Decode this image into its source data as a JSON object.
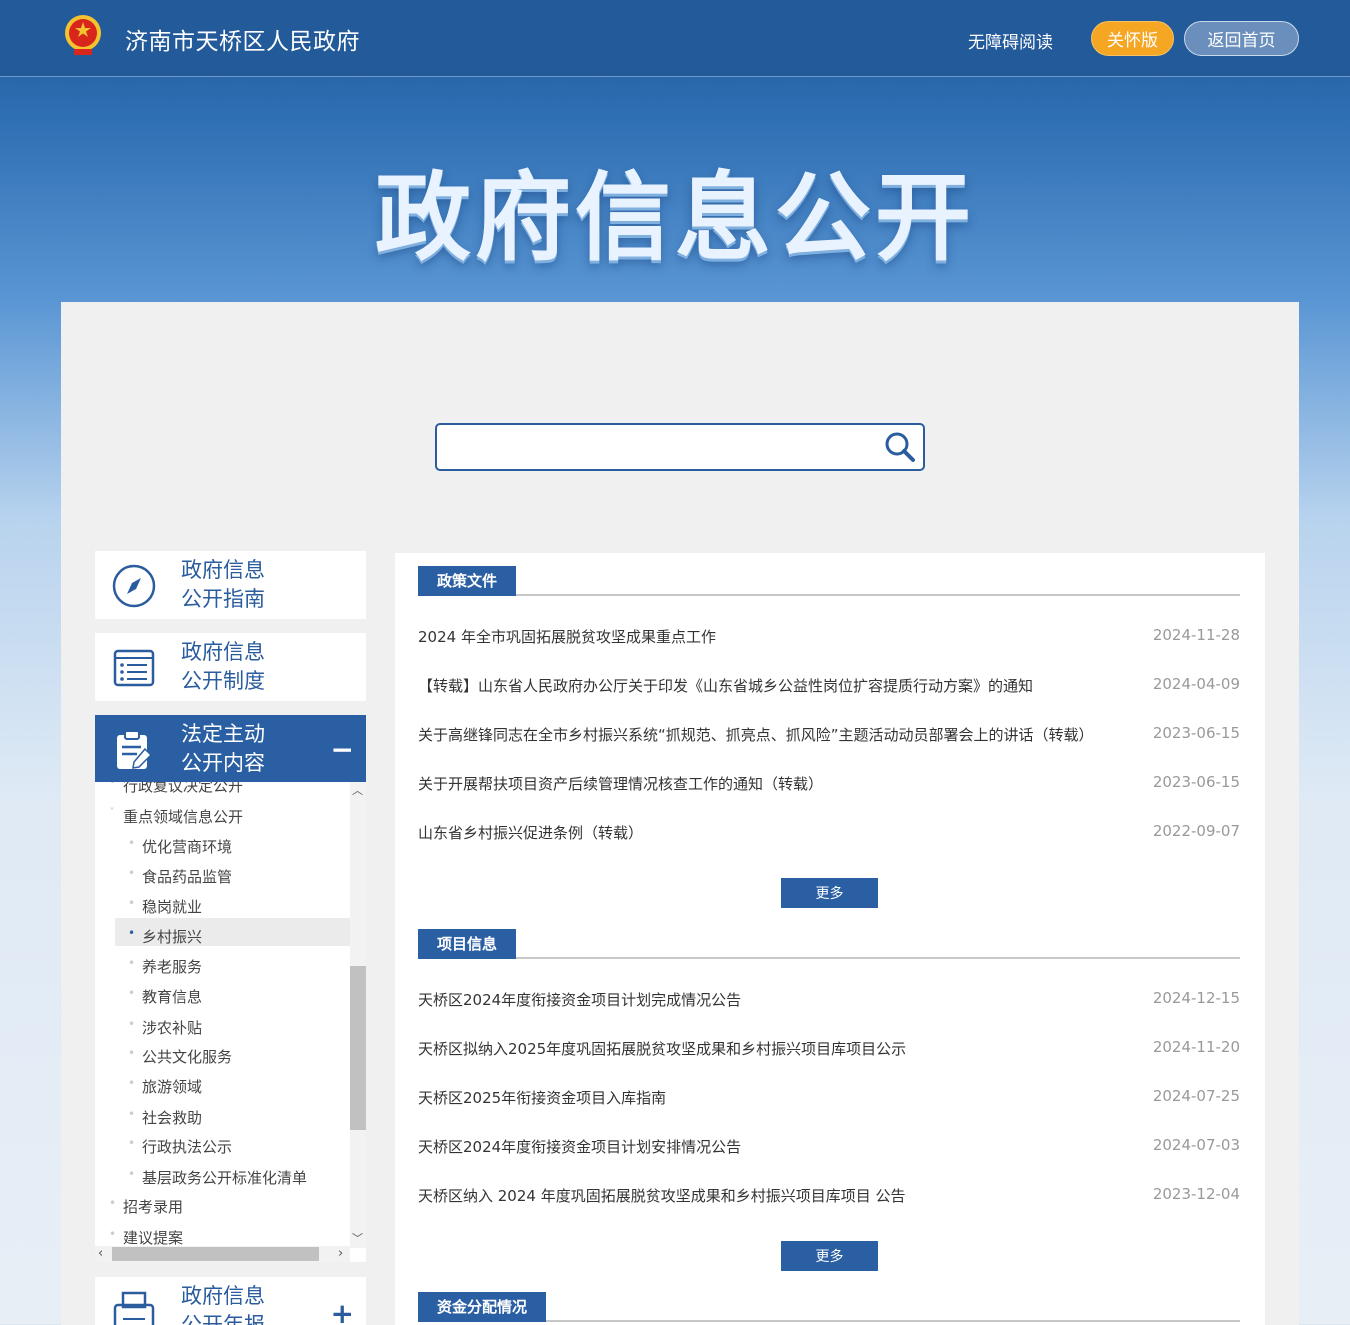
{
  "header": {
    "site_title": "济南市天桥区人民政府",
    "a11y_label": "无障碍阅读",
    "care_label": "关怀版",
    "home_label": "返回首页"
  },
  "hero": {
    "title": "政府信息公开"
  },
  "search": {
    "value": "",
    "placeholder": ""
  },
  "sidebar": {
    "cards": [
      {
        "label_1": "政府信息",
        "label_2": "公开指南",
        "icon": "compass-icon"
      },
      {
        "label_1": "政府信息",
        "label_2": "公开制度",
        "icon": "document-list-icon"
      },
      {
        "label_1": "法定主动",
        "label_2": "公开内容",
        "icon": "clipboard-edit-icon",
        "toggle": "−"
      },
      {
        "label_1": "政府信息",
        "label_2": "公开年报",
        "icon": "printer-icon",
        "toggle": "+"
      }
    ],
    "tree": [
      "行政复议决定公开",
      "重点领域信息公开",
      "优化营商环境",
      "食品药品监管",
      "稳岗就业",
      "乡村振兴",
      "养老服务",
      "教育信息",
      "涉农补贴",
      "公共文化服务",
      "旅游领域",
      "社会救助",
      "行政执法公示",
      "基层政务公开标准化清单",
      "招考录用",
      "建议提案"
    ],
    "selected": "乡村振兴"
  },
  "sections": [
    {
      "title": "政策文件",
      "items": [
        {
          "title": "2024 年全市巩固拓展脱贫攻坚成果重点工作",
          "date": "2024-11-28"
        },
        {
          "title": "【转载】山东省人民政府办公厅关于印发《山东省城乡公益性岗位扩容提质行动方案》的通知",
          "date": "2024-04-09"
        },
        {
          "title": "关于高继锋同志在全市乡村振兴系统“抓规范、抓亮点、抓风险”主题活动动员部署会上的讲话（转载）",
          "date": "2023-06-15"
        },
        {
          "title": "关于开展帮扶项目资产后续管理情况核查工作的通知（转载）",
          "date": "2023-06-15"
        },
        {
          "title": "山东省乡村振兴促进条例（转载）",
          "date": "2022-09-07"
        }
      ],
      "more": "更多"
    },
    {
      "title": "项目信息",
      "items": [
        {
          "title": "天桥区2024年度衔接资金项目计划完成情况公告",
          "date": "2024-12-15"
        },
        {
          "title": "天桥区拟纳入2025年度巩固拓展脱贫攻坚成果和乡村振兴项目库项目公示",
          "date": "2024-11-20"
        },
        {
          "title": "天桥区2025年衔接资金项目入库指南",
          "date": "2024-07-25"
        },
        {
          "title": "天桥区2024年度衔接资金项目计划安排情况公告",
          "date": "2024-07-03"
        },
        {
          "title": "天桥区纳入 2024 年度巩固拓展脱贫攻坚成果和乡村振兴项目库项目 公告",
          "date": "2023-12-04"
        }
      ],
      "more": "更多"
    },
    {
      "title": "资金分配情况",
      "items": []
    }
  ],
  "colors": {
    "primary": "#2b5fa3",
    "accent": "#f5a623",
    "header": "#235a9a"
  }
}
